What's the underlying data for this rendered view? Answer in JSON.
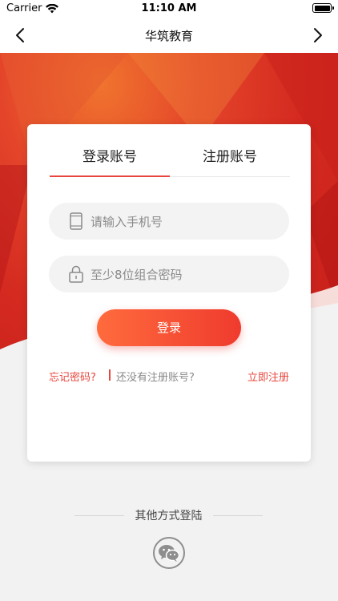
{
  "status_bar": {
    "carrier": "Carrier",
    "time": "11:10 AM"
  },
  "nav": {
    "title": "华筑教育",
    "back_icon": "chevron-left-icon",
    "forward_icon": "chevron-right-icon"
  },
  "tabs": [
    {
      "label": "登录账号",
      "active": true
    },
    {
      "label": "注册账号",
      "active": false
    }
  ],
  "form": {
    "phone_placeholder": "请输入手机号",
    "password_placeholder": "至少8位组合密码",
    "login_label": "登录"
  },
  "links": {
    "forgot": "忘记密码?",
    "no_account": "还没有注册账号?",
    "register_now": "立即注册"
  },
  "other_login": {
    "label": "其他方式登陆",
    "icon": "wechat-icon"
  },
  "colors": {
    "accent": "#e8453c",
    "button_start": "#ff6b3d",
    "button_end": "#ef3b2e",
    "hero": "#d42a20"
  }
}
